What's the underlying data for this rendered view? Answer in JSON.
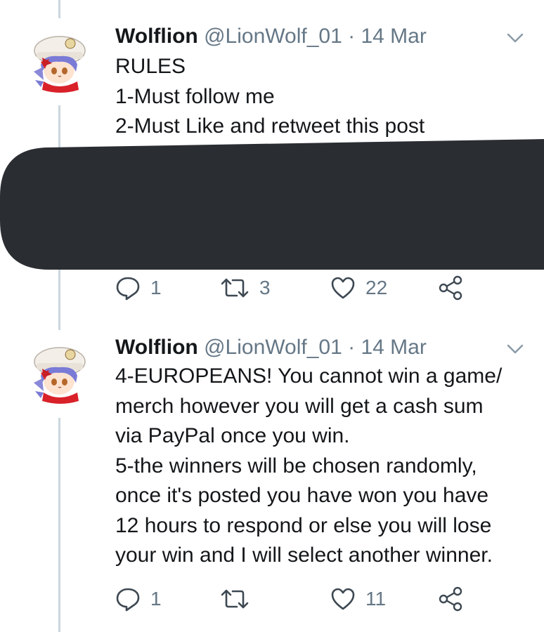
{
  "tweets": [
    {
      "display_name": "Wolflion",
      "handle": "@LionWolf_01",
      "separator": "·",
      "date": "14 Mar",
      "lines": [
        "RULES",
        "1-Must follow me",
        "2-Must Like and retweet this post"
      ],
      "replies": "1",
      "retweets": "3",
      "likes": "22"
    },
    {
      "display_name": "Wolflion",
      "handle": "@LionWolf_01",
      "separator": "·",
      "date": "14 Mar",
      "lines": [
        "4-EUROPEANS! You cannot win a game/",
        "merch however you will get a cash sum",
        "via PayPal once you win.",
        "5-the winners will be chosen randomly,",
        "once it's posted you have won you have",
        "12 hours to respond or else you will lose",
        "your win and I will select another winner."
      ],
      "replies": "1",
      "retweets": "",
      "likes": "11"
    }
  ],
  "colors": {
    "text": "#14171a",
    "secondary": "#657786",
    "thread_line": "#ccd6dd",
    "redaction": "#2a2d32"
  },
  "icons": {
    "reply": "reply-icon",
    "retweet": "retweet-icon",
    "like": "heart-icon",
    "share": "share-icon",
    "more": "chevron-down-icon"
  }
}
